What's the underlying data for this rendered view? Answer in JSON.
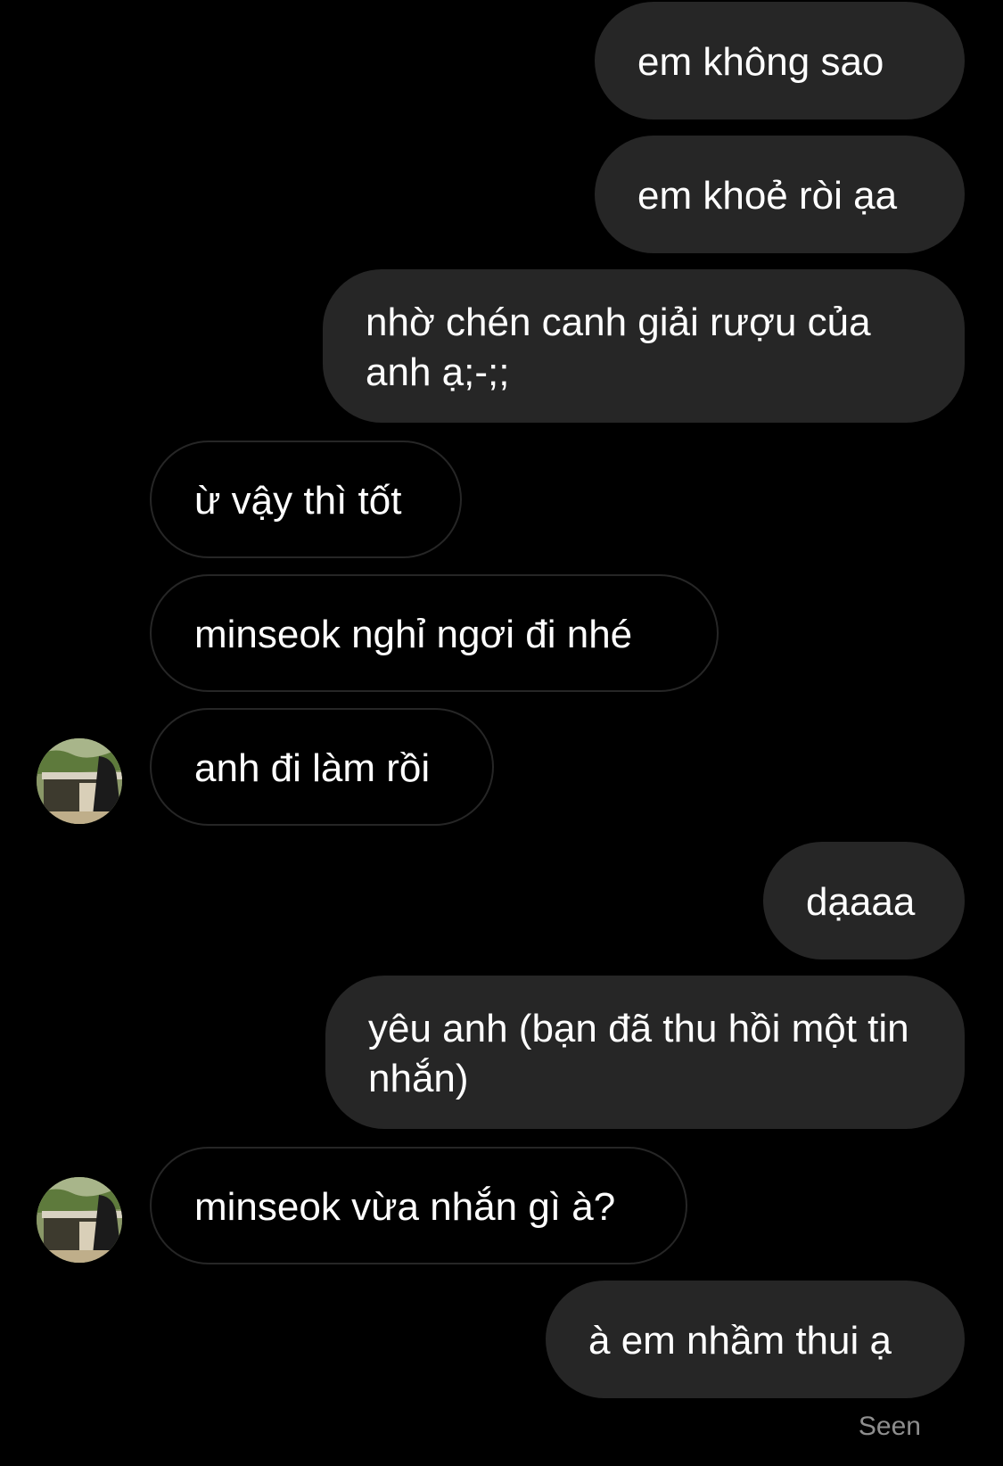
{
  "thread": {
    "messages": [
      {
        "direction": "outgoing",
        "text": "em không sao"
      },
      {
        "direction": "outgoing",
        "text": "em khoẻ ròi ạa"
      },
      {
        "direction": "outgoing",
        "text": "nhờ chén canh giải rượu của anh ạ;-;;"
      },
      {
        "direction": "incoming",
        "text": "ừ vậy thì tốt"
      },
      {
        "direction": "incoming",
        "text": "minseok nghỉ ngơi đi nhé"
      },
      {
        "direction": "incoming",
        "text": "anh đi làm rồi",
        "show_avatar": true
      },
      {
        "direction": "outgoing",
        "text": "dạaaa"
      },
      {
        "direction": "outgoing",
        "text": "yêu anh (bạn đã thu hồi một tin nhắn)"
      },
      {
        "direction": "incoming",
        "text": "minseok vừa nhắn gì à?",
        "show_avatar": true
      },
      {
        "direction": "outgoing",
        "text": "à em nhầm thui ạ"
      }
    ],
    "status": "Seen"
  },
  "colors": {
    "background": "#000000",
    "outgoing_bubble": "#262626",
    "incoming_border": "#262626",
    "text": "#ffffff",
    "status_text": "#8e8e8e"
  },
  "icons": {
    "avatar": "profile-photo-avatar"
  }
}
